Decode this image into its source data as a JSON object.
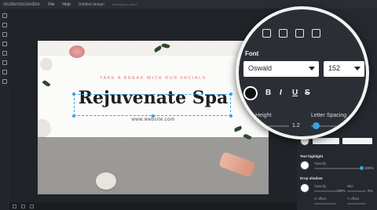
{
  "app": {
    "brand": "shutterstock",
    "brand_suffix": "editor",
    "menu": [
      "File",
      "Help"
    ],
    "doc_title": "Untitled design",
    "doc_subtitle": "Workspace saved"
  },
  "design": {
    "tagline": "TAKE A BREAK WITH OUR FACIALS",
    "headline": "Rejuvenate Spa",
    "website": "www.website.com"
  },
  "magnifier": {
    "section_title": "Font",
    "font_family": "Oswald",
    "font_size": "152",
    "style_buttons": [
      "B",
      "I",
      "U",
      "S"
    ],
    "line_height_label": "Line Height",
    "line_height_value": "1.2",
    "letter_spacing_label": "Letter Spacing",
    "letter_spacing_value": "0"
  },
  "panel": {
    "text_highlight_label": "Text highlight",
    "opacity_label": "Opacity",
    "highlight_opacity": "100%",
    "drop_shadow_label": "Drop shadow",
    "shadow_opacity_label": "Opacity",
    "shadow_blur_label": "Blur",
    "shadow_opacity": "100%",
    "shadow_blur": "0%",
    "x_offset_label": "X offset",
    "y_offset_label": "Y offset"
  },
  "colors": {
    "accent": "#3aa3e3",
    "tagline": "#d87a7a",
    "panel": "#25282e"
  }
}
